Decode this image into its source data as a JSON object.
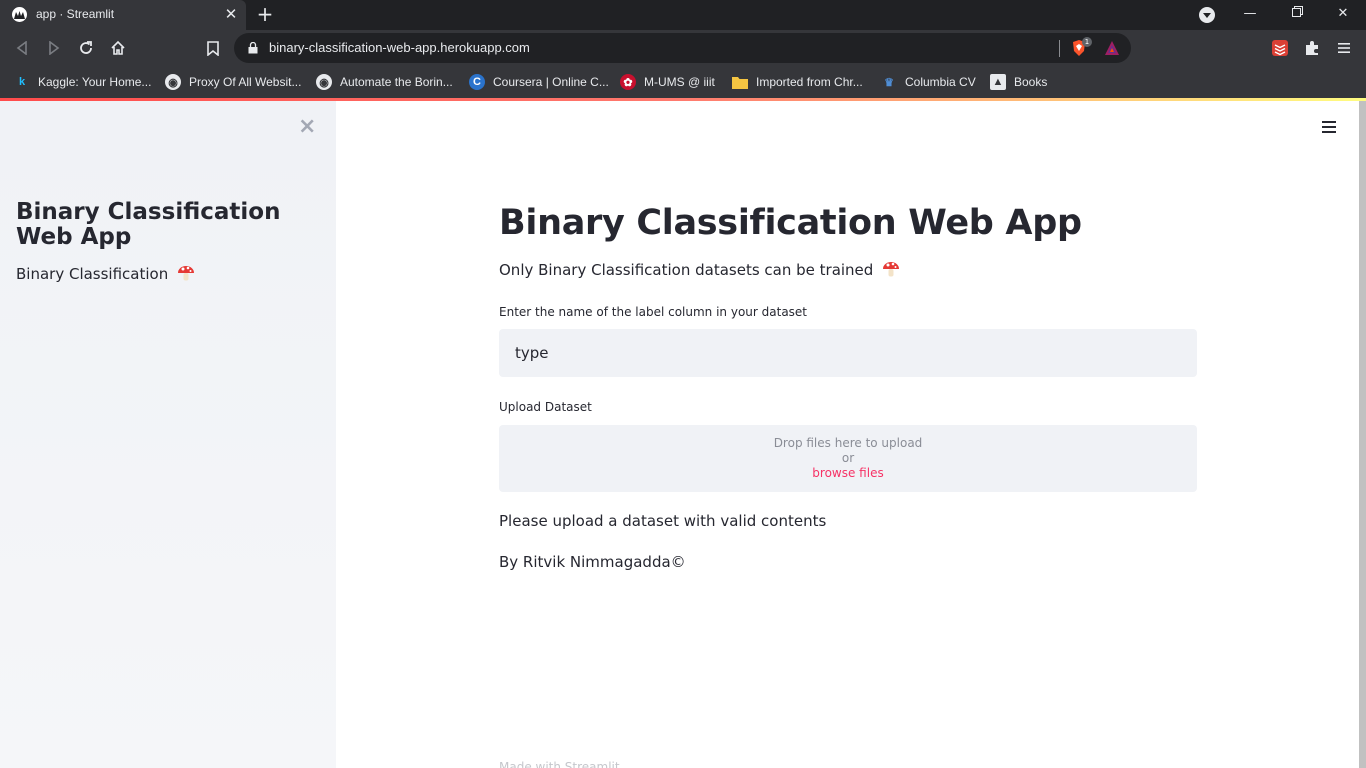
{
  "browser": {
    "tab_title": "app · Streamlit",
    "url": "binary-classification-web-app.herokuapp.com",
    "brave_badge": "1",
    "bookmarks": [
      {
        "label": "Kaggle: Your Home...",
        "icon": "kaggle-icon"
      },
      {
        "label": "Proxy Of All Websit...",
        "icon": "globe-icon"
      },
      {
        "label": "Automate the Borin...",
        "icon": "globe-icon"
      },
      {
        "label": "Coursera | Online C...",
        "icon": "coursera-icon"
      },
      {
        "label": "M-UMS @ iiit",
        "icon": "ums-icon"
      },
      {
        "label": "Imported from Chr...",
        "icon": "folder-icon"
      },
      {
        "label": "Columbia CV",
        "icon": "columbia-icon"
      },
      {
        "label": "Books",
        "icon": "books-icon"
      }
    ]
  },
  "sidebar": {
    "title": "Binary Classification Web App",
    "subtitle": "Binary Classification"
  },
  "main": {
    "title": "Binary Classification Web App",
    "subtitle": "Only Binary Classification datasets can be trained",
    "label_field": {
      "label": "Enter the name of the label column in your dataset",
      "value": "type"
    },
    "upload": {
      "label": "Upload Dataset",
      "drop_text": "Drop files here to upload",
      "or_text": "or",
      "browse_text": "browse files"
    },
    "warning": "Please upload a dataset with valid contents",
    "credit": "By Ritvik Nimmagadda©",
    "footer": "Made with Streamlit"
  },
  "colors": {
    "accent": "#f63366",
    "text": "#262730",
    "sidebar_bg": "#f0f2f6",
    "chrome_dark": "#202124",
    "chrome_toolbar": "#35363a"
  }
}
